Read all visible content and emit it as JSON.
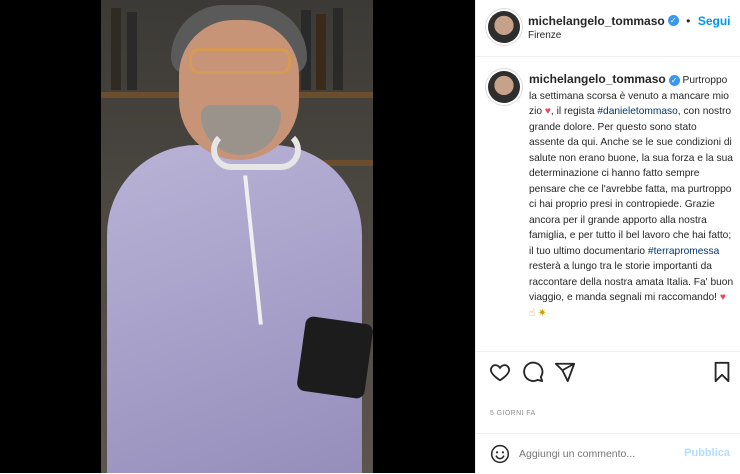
{
  "post": {
    "username": "michelangelo_tommaso",
    "verified_mark": "✓",
    "follow_label": "Segui",
    "location": "Firenze",
    "separator": "•"
  },
  "caption": {
    "username": "michelangelo_tommaso",
    "text_1": " Purtroppo la settimana scorsa è venuto a mancare mio zio ",
    "heart_1": "♥",
    "text_2": ", il regista ",
    "tag_1": "#danieletommaso",
    "text_3": ", con nostro grande dolore. Per questo sono stato assente da qui. Anche se le sue condizioni di salute non erano buone, la sua forza e la sua determinazione ci hanno fatto sempre pensare che ce l'avrebbe fatta, ma purtroppo ci hai proprio presi in contropiede. Grazie ancora per il grande apporto alla nostra famiglia, e per tutto il bel lavoro che hai fatto; il tuo ultimo documentario ",
    "tag_2": "#terrapromessa",
    "text_4": " resterà a lungo tra le storie importanti da raccontare della nostra amata Italia. Fa' buon viaggio, e manda segnali mi raccomando! ",
    "heart_2": "♥",
    "emoji_tail": "☝ ✷"
  },
  "actions": {
    "icons": [
      "heart-icon",
      "comment-icon",
      "share-icon",
      "bookmark-icon"
    ]
  },
  "date": "5 GIORNI FA",
  "comment": {
    "placeholder": "Aggiungi un commento...",
    "publish_label": "Pubblica",
    "emoji_icon": "smiley-icon"
  },
  "colors": {
    "link_blue": "#0095f6",
    "heart_red": "#ed4956",
    "verified_blue": "#3897f0"
  }
}
